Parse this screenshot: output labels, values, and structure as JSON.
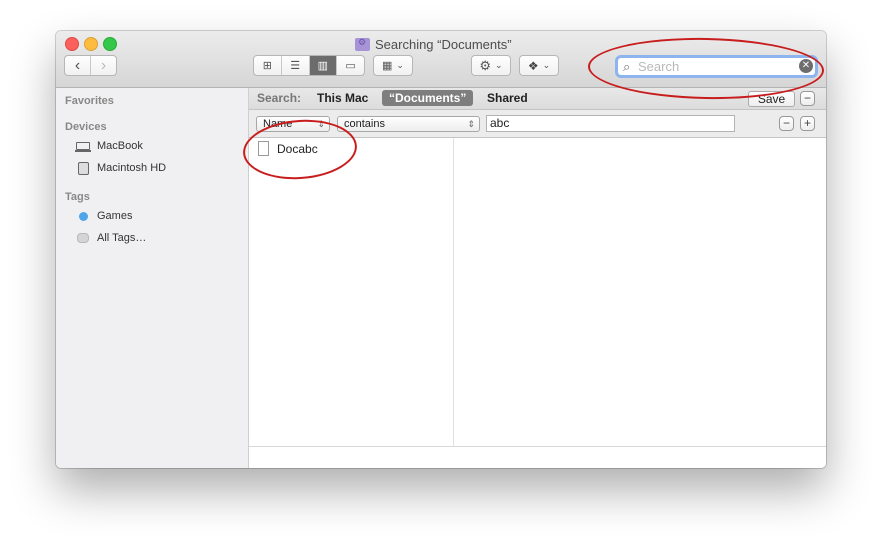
{
  "window": {
    "title": "Searching “Documents”"
  },
  "toolbar": {
    "back_icon": "‹",
    "forward_icon": "›",
    "view_icons": [
      "icon-view-icon",
      "list-view-icon",
      "column-view-icon",
      "cover-flow-icon"
    ],
    "view_glyphs": [
      "⊞",
      "☰",
      "▥",
      "▭"
    ],
    "arrange_glyph": "▦",
    "action_glyph": "⚙",
    "dropbox_glyph": "❖",
    "chevron": "⌄"
  },
  "search": {
    "placeholder": "Search",
    "value": ""
  },
  "sidebar": {
    "favorites_heading": "Favorites",
    "devices_heading": "Devices",
    "devices": [
      {
        "label": "MacBook",
        "icon": "laptop-icon"
      },
      {
        "label": "Macintosh HD",
        "icon": "hard-drive-icon"
      }
    ],
    "tags_heading": "Tags",
    "tags": [
      {
        "label": "Games",
        "icon": "tag-dot-icon",
        "color": "#4ea5ea"
      },
      {
        "label": "All Tags…",
        "icon": "all-tags-icon"
      }
    ]
  },
  "scope": {
    "label": "Search:",
    "options": [
      "This Mac",
      "“Documents”",
      "Shared"
    ],
    "selected": "“Documents”",
    "save_label": "Save",
    "remove_label": "−"
  },
  "rule": {
    "attribute": "Name",
    "operator": "contains",
    "value": "abc",
    "remove_label": "−",
    "add_label": "+"
  },
  "results": [
    {
      "name": "Docabc",
      "icon": "document-icon"
    }
  ],
  "annotation_color": "#c81d1d"
}
